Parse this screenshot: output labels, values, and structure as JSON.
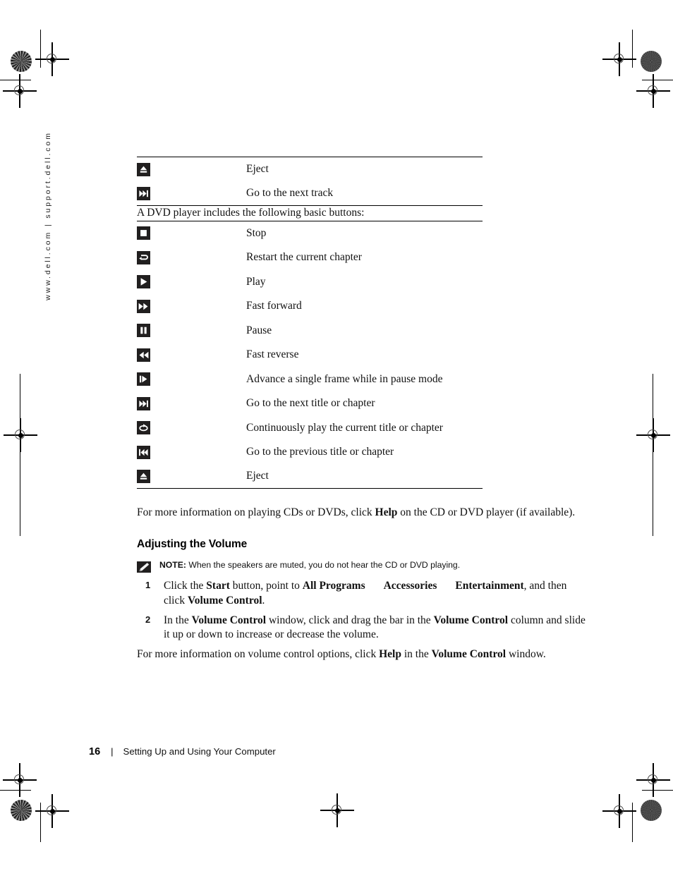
{
  "sidebar": {
    "url_text": "www.dell.com | support.dell.com"
  },
  "cd_table": {
    "rows": [
      {
        "icon": "eject-icon",
        "label": "Eject"
      },
      {
        "icon": "next-track-icon",
        "label": "Go to the next track"
      }
    ]
  },
  "intro": {
    "dvd_paragraph": "A DVD player includes the following basic buttons:"
  },
  "dvd_table": {
    "rows": [
      {
        "icon": "stop-icon",
        "label": "Stop"
      },
      {
        "icon": "restart-chapter-icon",
        "label": "Restart the current chapter"
      },
      {
        "icon": "play-icon",
        "label": "Play"
      },
      {
        "icon": "fast-forward-icon",
        "label": "Fast forward"
      },
      {
        "icon": "pause-icon",
        "label": "Pause"
      },
      {
        "icon": "fast-reverse-icon",
        "label": "Fast reverse"
      },
      {
        "icon": "single-frame-advance-icon",
        "label": "Advance a single frame while in pause mode"
      },
      {
        "icon": "next-title-icon",
        "label": "Go to the next title or chapter"
      },
      {
        "icon": "repeat-icon",
        "label": "Continuously play the current title or chapter"
      },
      {
        "icon": "previous-title-icon",
        "label": "Go to the previous title or chapter"
      },
      {
        "icon": "eject-icon",
        "label": "Eject"
      }
    ]
  },
  "more_info": {
    "part1": "For more information on playing CDs or DVDs, click ",
    "help_bold": "Help",
    "part2": " on the CD or DVD player (if available)."
  },
  "volume_section": {
    "heading": "Adjusting the Volume",
    "note_label": "NOTE:",
    "note_text": "When the speakers are muted, you do not hear the CD or DVD playing.",
    "steps": [
      {
        "num": "1",
        "p1": "Click the ",
        "b1": "Start",
        "p2": " button, point to ",
        "b2": "All Programs",
        "p3": "",
        "b3": "Accessories",
        "p4": "",
        "b4": "Entertainment",
        "p5": ", and then click ",
        "b5": "Volume Control",
        "p6": "."
      },
      {
        "num": "2",
        "p1": "In the ",
        "b1": "Volume Control",
        "p2": " window, click and drag the bar in the ",
        "b2": "Volume Control",
        "p3": " column and slide it up or down to increase or decrease the volume."
      }
    ],
    "closing": {
      "part1": "For more information on volume control options, click ",
      "b1": "Help",
      "part2": " in the ",
      "b2": "Volume Control",
      "part3": " window."
    }
  },
  "footer": {
    "page_number": "16",
    "separator": "|",
    "chapter": "Setting Up and Using Your Computer"
  }
}
